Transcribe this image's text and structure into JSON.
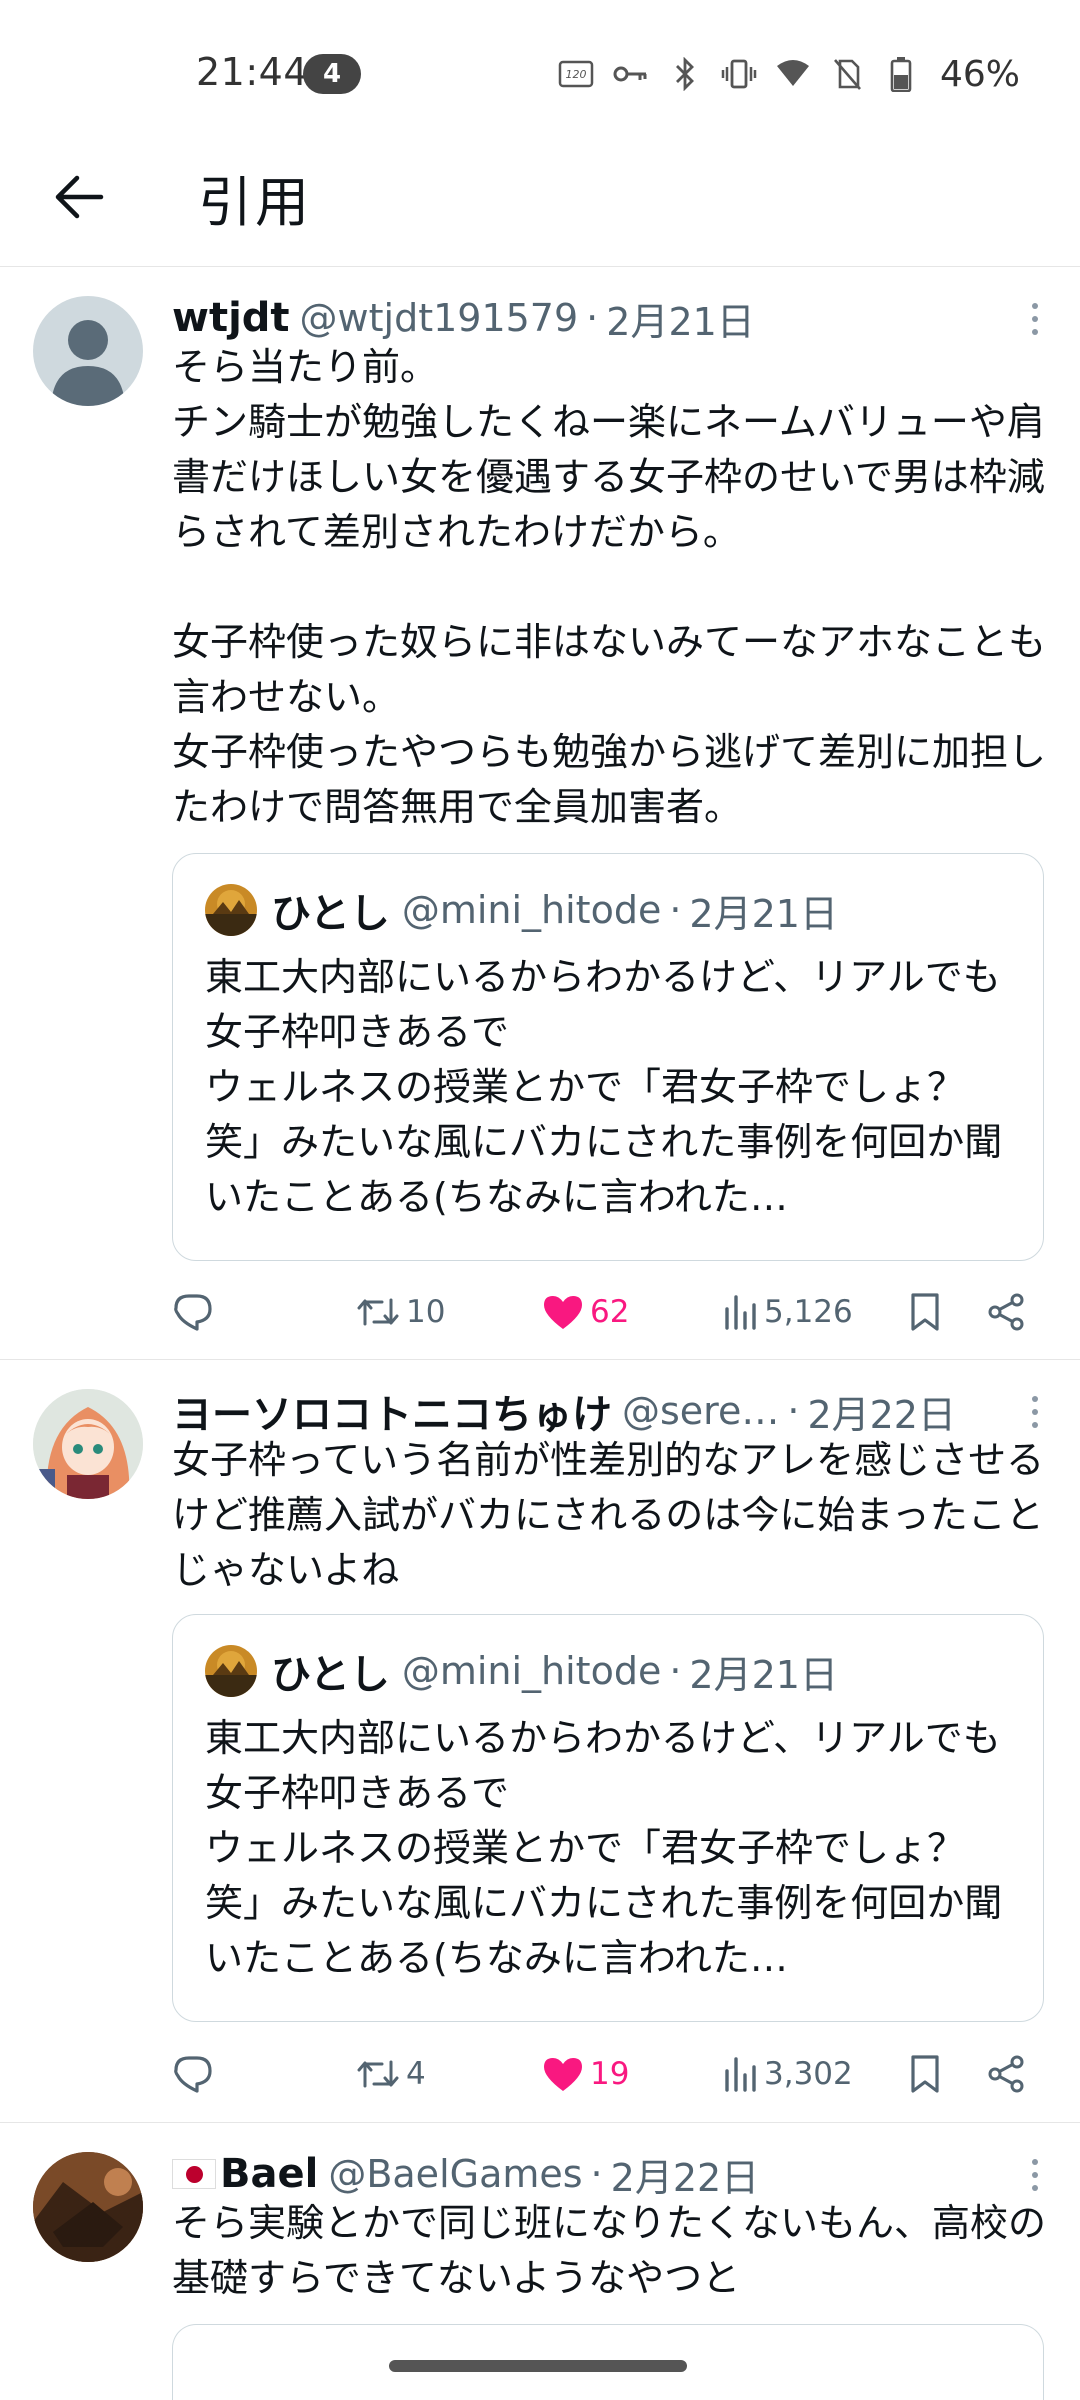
{
  "status_bar": {
    "time": "21:44",
    "notification_count": "4",
    "battery": "46%",
    "icons": [
      "refresh-rate-120hz-icon",
      "vpn-key-icon",
      "bluetooth-icon",
      "vibrate-icon",
      "wifi-icon",
      "no-sim-icon",
      "battery-icon"
    ]
  },
  "header": {
    "back_icon": "arrow-left-icon",
    "title": "引用"
  },
  "tweets": [
    {
      "name": "wtjdt",
      "handle": "@wtjdt191579",
      "date": "2月21日",
      "text": "そら当たり前。\nチン騎士が勉強したくねー楽にネームバリューや肩書だけほしい女を優遇する女子枠のせいで男は枠減らされて差別されたわけだから。\n\n女子枠使った奴らに非はないみてーなアホなことも言わせない。\n女子枠使ったやつらも勉強から逃げて差別に加担したわけで問答無用で全員加害者。",
      "quote": {
        "name": "ひとし",
        "handle": "@mini_hitode",
        "date": "2月21日",
        "text": "東工大内部にいるからわかるけど、リアルでも女子枠叩きあるで\nウェルネスの授業とかで「君女子枠でしょ？笑」みたいな風にバカにされた事例を何回か聞いたことある(ちなみに言われた…"
      },
      "replies": "",
      "retweets": "10",
      "likes": "62",
      "views": "5,126"
    },
    {
      "name": "ヨーソロコトニコちゅけ",
      "handle": "@sere…",
      "date": "2月22日",
      "text": "女子枠っていう名前が性差別的なアレを感じさせるけど推薦入試がバカにされるのは今に始まったことじゃないよね",
      "quote": {
        "name": "ひとし",
        "handle": "@mini_hitode",
        "date": "2月21日",
        "text": "東工大内部にいるからわかるけど、リアルでも女子枠叩きあるで\nウェルネスの授業とかで「君女子枠でしょ？笑」みたいな風にバカにされた事例を何回か聞いたことある(ちなみに言われた…"
      },
      "replies": "",
      "retweets": "4",
      "likes": "19",
      "views": "3,302"
    },
    {
      "flag": "🇯🇵",
      "name": "Bael",
      "handle": "@BaelGames",
      "date": "2月22日",
      "text": "そら実験とかで同じ班になりたくないもん、高校の基礎すらできてないようなやつと"
    }
  ],
  "colors": {
    "text": "#0f1419",
    "secondary": "#536471",
    "like": "#f91880",
    "border": "#cfd9de"
  }
}
